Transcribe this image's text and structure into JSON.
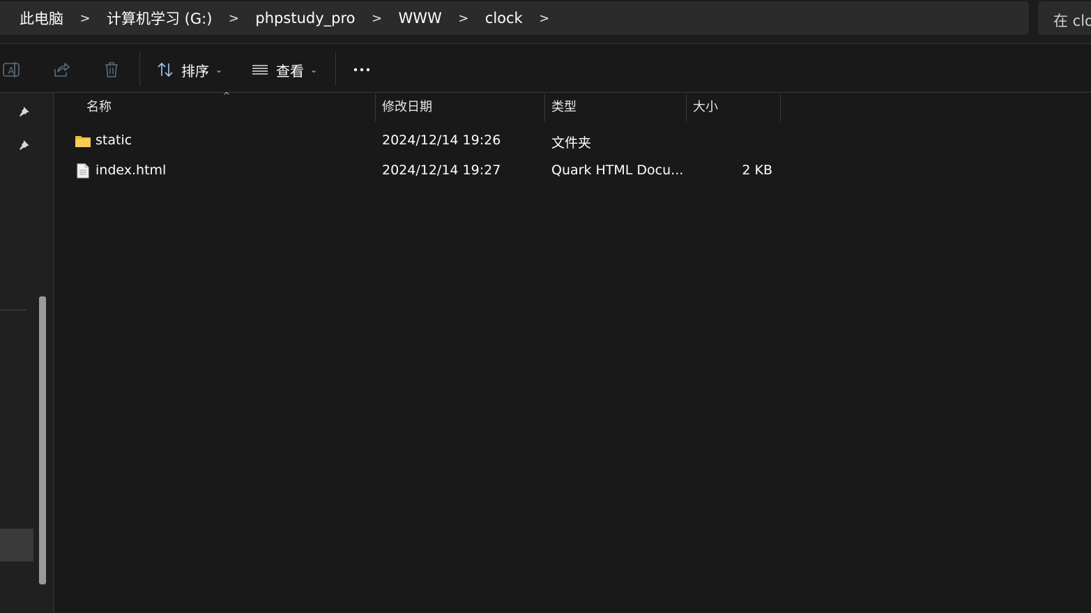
{
  "breadcrumb": {
    "items": [
      "此电脑",
      "计算机学习 (G:)",
      "phpstudy_pro",
      "WWW",
      "clock"
    ],
    "separator": ">"
  },
  "search": {
    "placeholder": "在 clock 中搜索"
  },
  "toolbar": {
    "icons": [
      "rename-icon",
      "share-icon",
      "delete-icon"
    ],
    "sort_label": "排序",
    "view_label": "查看",
    "more_label": "..."
  },
  "columns": {
    "name": "名称",
    "date": "修改日期",
    "type": "类型",
    "size": "大小"
  },
  "files": [
    {
      "icon": "folder-icon",
      "name": "static",
      "date": "2024/12/14 19:26",
      "type": "文件夹",
      "size": ""
    },
    {
      "icon": "file-icon",
      "name": "index.html",
      "date": "2024/12/14 19:27",
      "type": "Quark HTML Docu...",
      "size": "2 KB"
    }
  ],
  "colors": {
    "background": "#191919",
    "address_bar": "#2b2b2b",
    "folder": "#f0c34a",
    "accent": "#4aa3e8"
  }
}
